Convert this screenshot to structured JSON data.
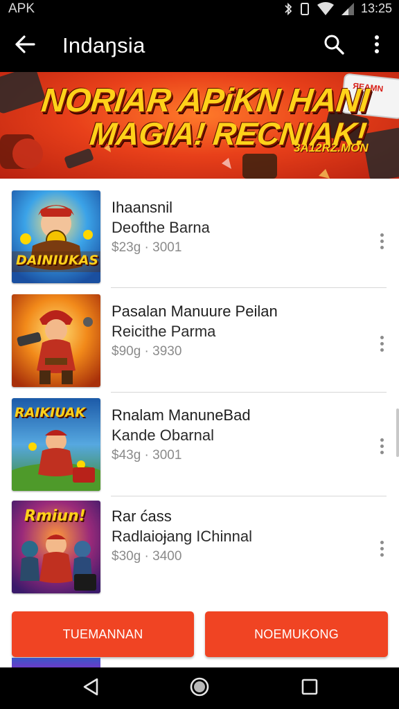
{
  "status_bar": {
    "app_label": "APK",
    "time": "13:25",
    "icons": [
      "bluetooth-icon",
      "vibrate-icon",
      "wifi-icon",
      "signal-icon",
      "battery-icon"
    ]
  },
  "app_bar": {
    "title": "Indaŋsia",
    "icons": [
      "arrow-back-icon",
      "search-icon",
      "more-vert-icon"
    ]
  },
  "banner": {
    "line1": "NORIAR APiKN HANI",
    "line2": "MAGIA! RECNIAK!",
    "badge": "3A12RZ.MON",
    "phone_label": "ЯEAMN",
    "colors": {
      "background": "#e8401a",
      "text": "#ffd21a"
    }
  },
  "apps": [
    {
      "title": "Ihaansnil",
      "subtitle": "Deofthe Barna",
      "meta": "$23g · 3001",
      "thumb_text": "DAINIUKAS"
    },
    {
      "title": "Pasalan Manuure Peilan",
      "subtitle": "Reicithe Parma",
      "meta": "$90g · 3930",
      "thumb_text": ""
    },
    {
      "title": "Rnalam ManuneBad",
      "subtitle": "Kande Obarnal",
      "meta": "$43g · 3001",
      "thumb_text": "RAIKIUAK"
    },
    {
      "title": "Rar ćass",
      "subtitle": "Radlaioɉang IChinnal",
      "meta": "$30g · 3400",
      "thumb_text": "Rmiun!"
    }
  ],
  "buttons": {
    "left_label": "TUEMANNAN",
    "right_label": "NOEMUKONG"
  },
  "colors": {
    "accent": "#f04423",
    "app_bar": "#000000",
    "divider": "#d7d7d7",
    "meta_text": "#8a8a8a"
  }
}
